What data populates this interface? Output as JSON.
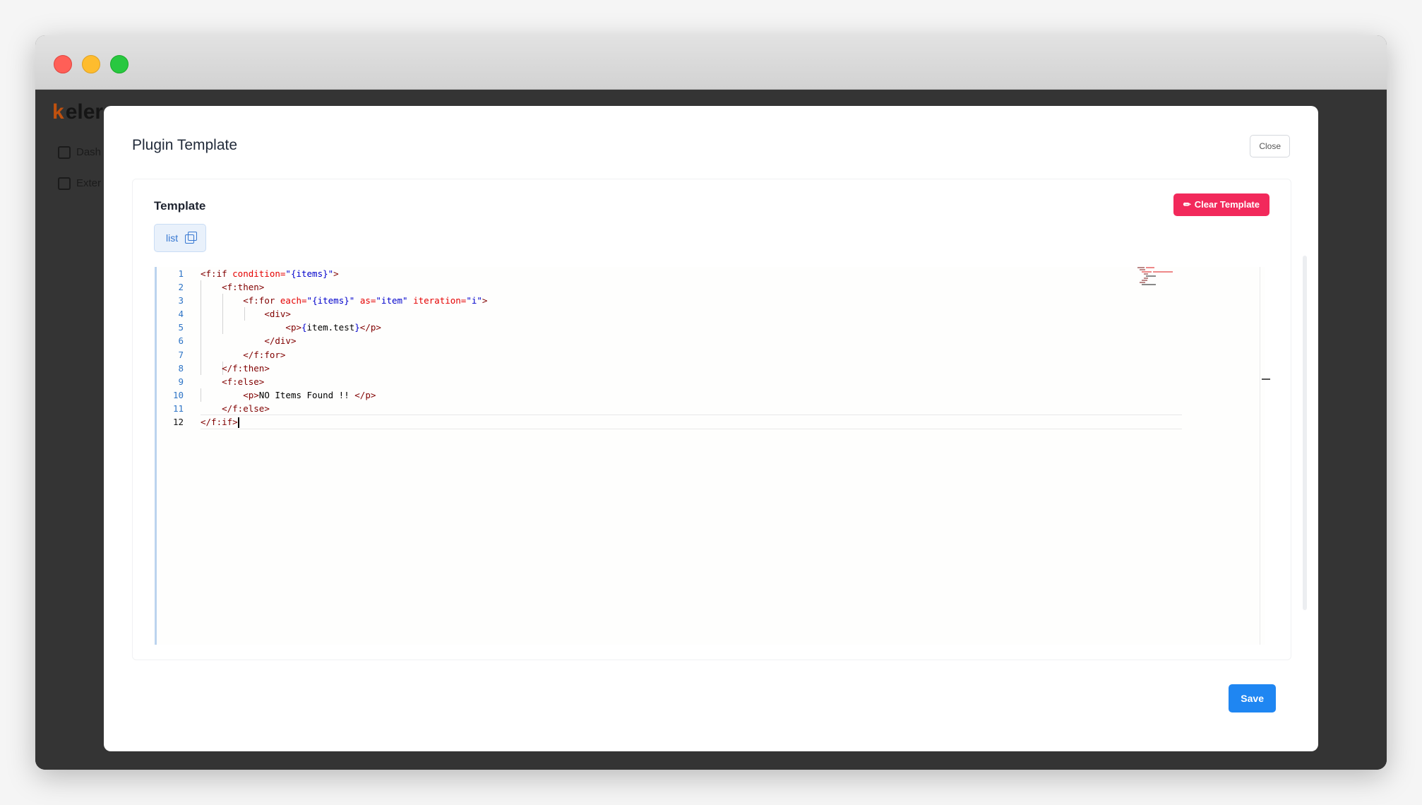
{
  "background_app": {
    "logo_text": "eler",
    "nav_items": [
      {
        "label": "Dash",
        "icon": "grid-icon"
      },
      {
        "label": "Exter",
        "icon": "extensions-icon"
      }
    ]
  },
  "modal": {
    "title": "Plugin Template",
    "close_label": "Close",
    "section_title": "Template",
    "clear_label": "Clear Template",
    "clear_icon": "eraser-icon",
    "variable_tag": "list",
    "save_label": "Save"
  },
  "editor": {
    "line_numbers": [
      "1",
      "2",
      "3",
      "4",
      "5",
      "6",
      "7",
      "8",
      "9",
      "10",
      "11",
      "12"
    ],
    "active_line": 12,
    "colors": {
      "tag": "#800000",
      "attribute": "#e50000",
      "string": "#0000cc",
      "text": "#000000"
    }
  },
  "colors": {
    "clear_button": "#f2295b",
    "save_button": "#1f86f2",
    "tag_bg": "#e9f1fb"
  }
}
